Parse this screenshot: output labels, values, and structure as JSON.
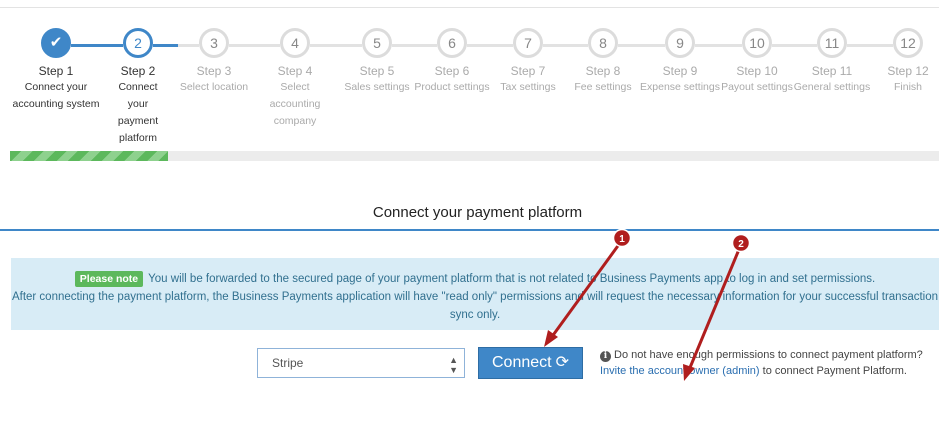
{
  "steps": [
    {
      "number": "1",
      "title": "Step 1",
      "desc": "Connect your accounting system",
      "state": "done"
    },
    {
      "number": "2",
      "title": "Step 2",
      "desc": "Connect your payment platform",
      "state": "active"
    },
    {
      "number": "3",
      "title": "Step 3",
      "desc": "Select location",
      "state": "todo"
    },
    {
      "number": "4",
      "title": "Step 4",
      "desc": "Select accounting company",
      "state": "todo"
    },
    {
      "number": "5",
      "title": "Step 5",
      "desc": "Sales settings",
      "state": "todo"
    },
    {
      "number": "6",
      "title": "Step 6",
      "desc": "Product settings",
      "state": "todo"
    },
    {
      "number": "7",
      "title": "Step 7",
      "desc": "Tax settings",
      "state": "todo"
    },
    {
      "number": "8",
      "title": "Step 8",
      "desc": "Fee settings",
      "state": "todo"
    },
    {
      "number": "9",
      "title": "Step 9",
      "desc": "Expense settings",
      "state": "todo"
    },
    {
      "number": "10",
      "title": "Step 10",
      "desc": "Payout settings",
      "state": "todo"
    },
    {
      "number": "11",
      "title": "Step 11",
      "desc": "General settings",
      "state": "todo"
    },
    {
      "number": "12",
      "title": "Step 12",
      "desc": "Finish",
      "state": "todo"
    }
  ],
  "progress_fraction": 0.17,
  "page_title": "Connect your payment platform",
  "notice": {
    "badge": "Please note",
    "line1": "You will be forwarded to the secured page of your payment platform that is not related to Business Payments app to log in and set permissions.",
    "line2": "After connecting the payment platform, the Business Payments application will have \"read only\" permissions and will request the necessary information for your successful transaction sync only."
  },
  "platform_select": {
    "value": "Stripe"
  },
  "connect_button": {
    "label": "Connect",
    "icon": "refresh-icon"
  },
  "permissions": {
    "question": "Do not have enough permissions to connect payment platform?",
    "invite_link": "Invite the account owner (admin)",
    "suffix": "to connect Payment Platform."
  },
  "annotations": {
    "marker1": "1",
    "marker2": "2",
    "color": "#b01e1e"
  },
  "colors": {
    "primary": "#3f87c8",
    "success": "#5cb85c",
    "info_bg": "#d8ecf6",
    "info_text": "#31708f"
  }
}
